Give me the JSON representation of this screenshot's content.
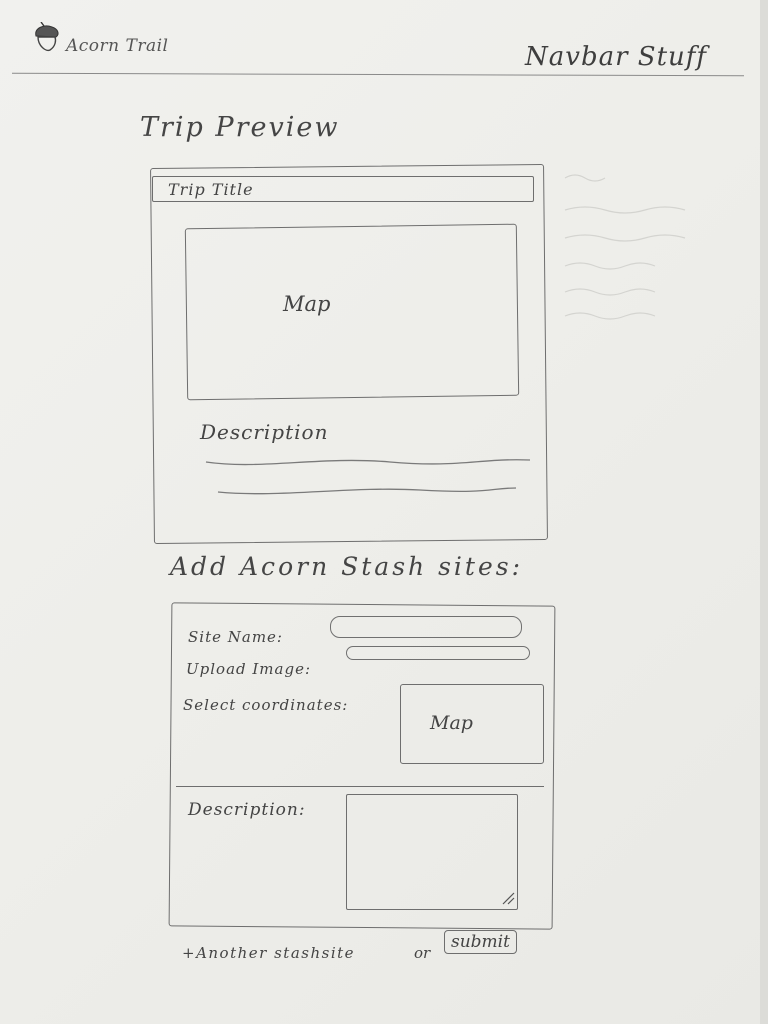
{
  "navbar": {
    "logo_text": "Acorn Trail",
    "right_text": "Navbar Stuff"
  },
  "trip_preview": {
    "heading": "Trip Preview",
    "title_field": "Trip Title",
    "map_label": "Map",
    "description_label": "Description"
  },
  "stash_sites": {
    "heading": "Add Acorn Stash sites:",
    "site_name_label": "Site Name:",
    "upload_image_label": "Upload Image:",
    "coordinates_label": "Select coordinates:",
    "map_label": "Map",
    "description_label": "Description:",
    "another_link": "+Another stashsite",
    "or_text": "or",
    "submit_label": "submit"
  }
}
